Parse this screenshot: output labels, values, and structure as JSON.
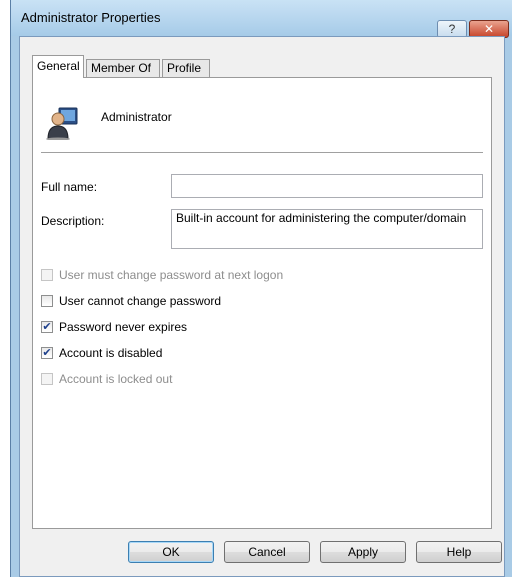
{
  "window": {
    "title": "Administrator Properties",
    "help_label": "?",
    "close_label": "✕"
  },
  "tabs": [
    {
      "label": "General",
      "active": true
    },
    {
      "label": "Member Of",
      "active": false
    },
    {
      "label": "Profile",
      "active": false
    }
  ],
  "general": {
    "user_icon": "user-icon",
    "user_name": "Administrator",
    "full_name_label": "Full name:",
    "full_name_value": "",
    "description_label": "Description:",
    "description_value": "Built-in account for administering the computer/domain",
    "checkboxes": [
      {
        "label": "User must change password at next logon",
        "checked": false,
        "enabled": false
      },
      {
        "label": "User cannot change password",
        "checked": false,
        "enabled": true
      },
      {
        "label": "Password never expires",
        "checked": true,
        "enabled": true
      },
      {
        "label": "Account is disabled",
        "checked": true,
        "enabled": true
      },
      {
        "label": "Account is locked out",
        "checked": false,
        "enabled": false
      }
    ]
  },
  "buttons": {
    "ok": "OK",
    "cancel": "Cancel",
    "apply": "Apply",
    "help": "Help"
  },
  "colors": {
    "frame": "#a9cbe6",
    "close": "#c7442a",
    "check": "#1d3f8b"
  }
}
